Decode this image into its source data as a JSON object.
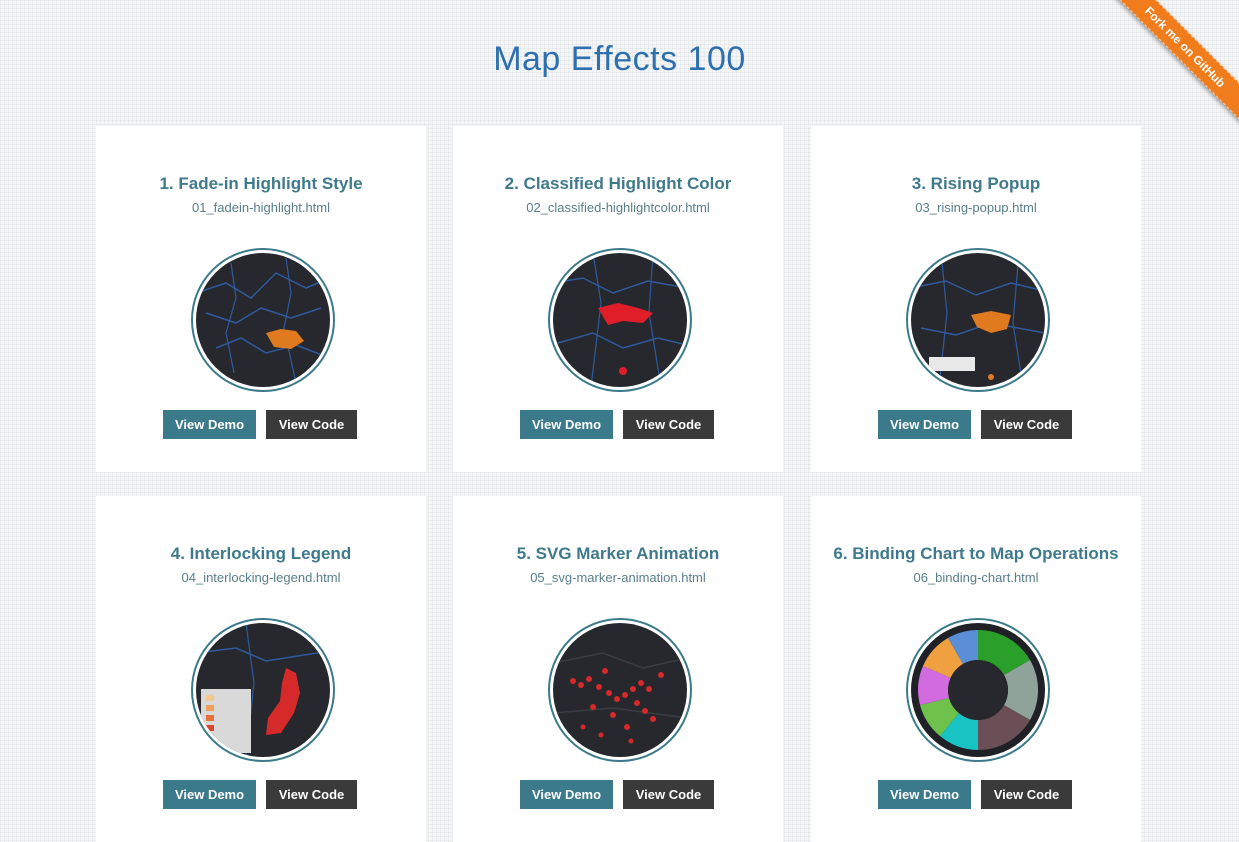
{
  "page": {
    "title": "Map Effects 100"
  },
  "ribbon": {
    "label": "Fork me on GitHub",
    "color": "#f07c1b"
  },
  "colors": {
    "accent": "#3b7a8a",
    "title": "#2e6fb0",
    "code_button": "#3a3a3a"
  },
  "cards": [
    {
      "title": "1. Fade-in Highlight Style",
      "file": "01_fadein-highlight.html",
      "demo_label": "View Demo",
      "code_label": "View Code",
      "thumb_icon": "dark-map-orange-highlight"
    },
    {
      "title": "2. Classified Highlight Color",
      "file": "02_classified-highlightcolor.html",
      "demo_label": "View Demo",
      "code_label": "View Code",
      "thumb_icon": "dark-map-red-highlight"
    },
    {
      "title": "3. Rising Popup",
      "file": "03_rising-popup.html",
      "demo_label": "View Demo",
      "code_label": "View Code",
      "thumb_icon": "dark-map-popup"
    },
    {
      "title": "4. Interlocking Legend",
      "file": "04_interlocking-legend.html",
      "demo_label": "View Demo",
      "code_label": "View Code",
      "thumb_icon": "dark-map-legend"
    },
    {
      "title": "5. SVG Marker Animation",
      "file": "05_svg-marker-animation.html",
      "demo_label": "View Demo",
      "code_label": "View Code",
      "thumb_icon": "dark-map-markers"
    },
    {
      "title": "6. Binding Chart to Map Operations",
      "file": "06_binding-chart.html",
      "demo_label": "View Demo",
      "code_label": "View Code",
      "thumb_icon": "donut-chart"
    }
  ]
}
